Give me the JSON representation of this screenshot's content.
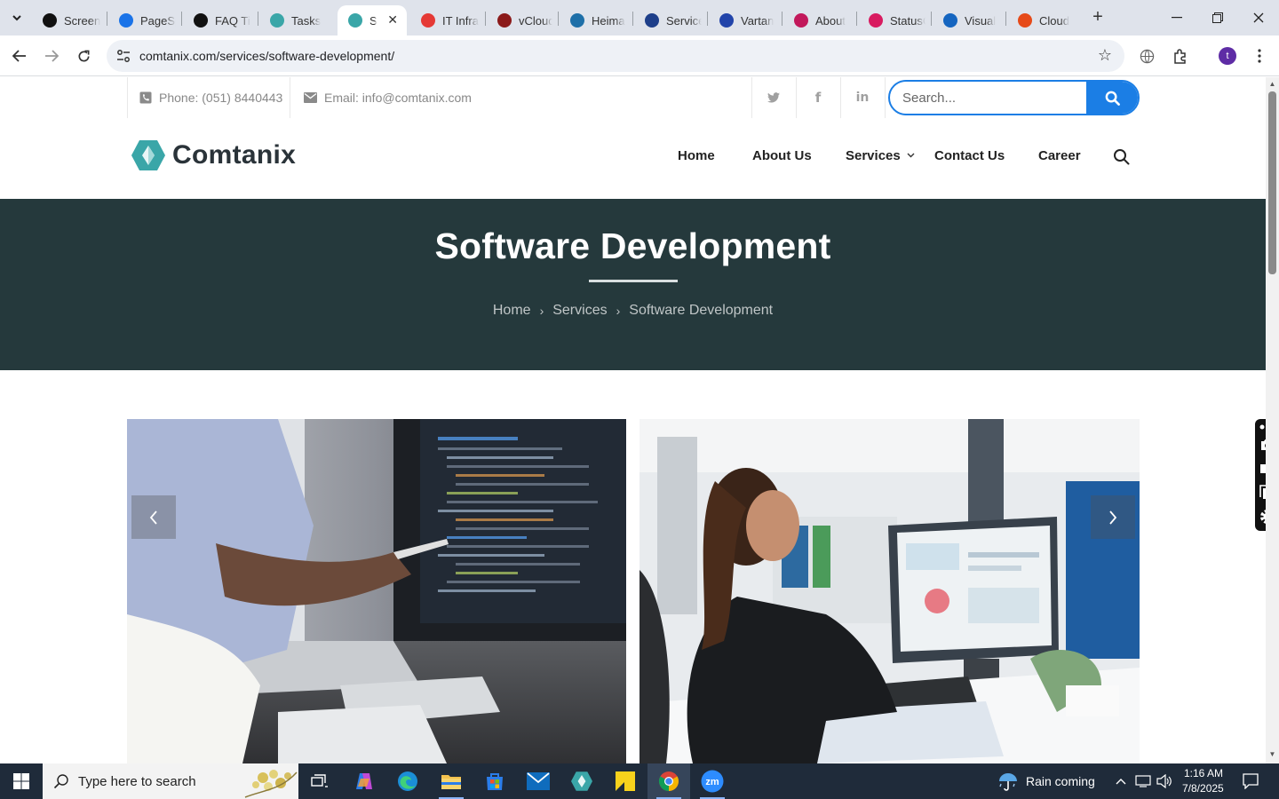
{
  "browser": {
    "tabs": [
      {
        "title": "Screen",
        "favicon": "screen-icon",
        "color": "#111"
      },
      {
        "title": "PageSp",
        "favicon": "pagespeed-icon",
        "color": "#1a73e8"
      },
      {
        "title": "FAQ Ti",
        "favicon": "faq-icon",
        "color": "#111"
      },
      {
        "title": "Tasks",
        "favicon": "tasks-icon",
        "color": "#3aa6a8"
      },
      {
        "title": "So",
        "favicon": "comtanix-icon",
        "color": "#3aa6a8",
        "active": true
      },
      {
        "title": "IT Infra",
        "favicon": "itinfra-icon",
        "color": "#e53935"
      },
      {
        "title": "vCloud",
        "favicon": "vcloud-icon",
        "color": "#8b1a1a"
      },
      {
        "title": "Heima",
        "favicon": "heima-icon",
        "color": "#1e6fa8"
      },
      {
        "title": "Service",
        "favicon": "service-icon",
        "color": "#1e3f8a"
      },
      {
        "title": "Vartan",
        "favicon": "vartan-icon",
        "color": "#2244aa"
      },
      {
        "title": "About",
        "favicon": "about-icon",
        "color": "#c2185b"
      },
      {
        "title": "StatusC",
        "favicon": "status-icon",
        "color": "#d81b60"
      },
      {
        "title": "Visual",
        "favicon": "visual-icon",
        "color": "#1565c0"
      },
      {
        "title": "Cloud",
        "favicon": "cloud-icon",
        "color": "#e64a19"
      }
    ],
    "url": "comtanix.com/services/software-development/",
    "profile_initial": "t"
  },
  "site": {
    "phone": "Phone: (051) 8440443",
    "email": "Email: info@comtanix.com",
    "search_placeholder": "Search...",
    "logo_text": "Comtanix",
    "nav": [
      "Home",
      "About Us",
      "Services",
      "Contact Us",
      "Career"
    ],
    "hero_title": "Software Development",
    "breadcrumb": [
      "Home",
      "Services",
      "Software Development"
    ]
  },
  "taskbar": {
    "search_placeholder": "Type here to search",
    "weather": "Rain coming",
    "time": "1:16 AM",
    "date": "7/8/2025"
  },
  "colors": {
    "accent": "#1b7ee5",
    "hero_bg": "#25393c",
    "brand_teal": "#3aa6a8"
  }
}
